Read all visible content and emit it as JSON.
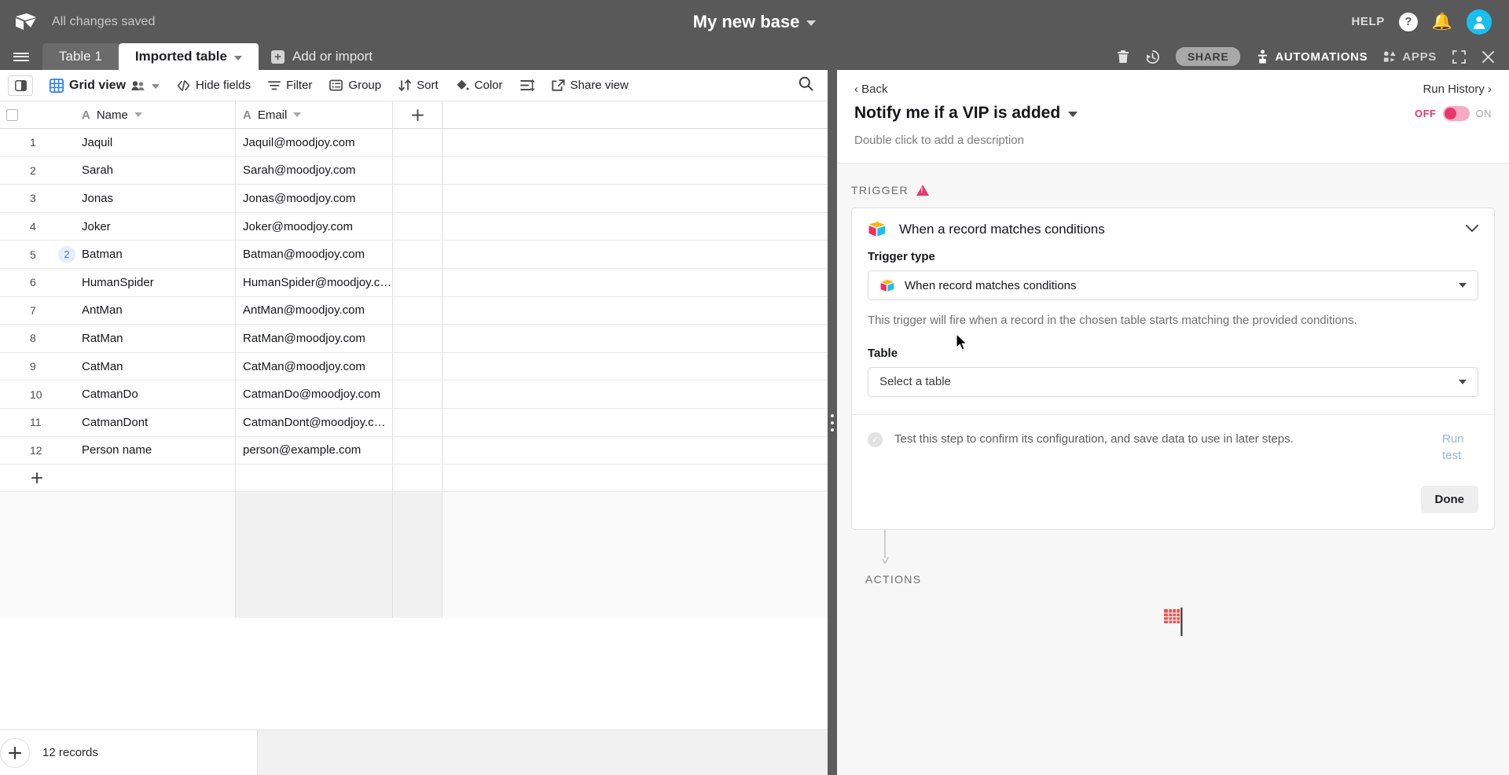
{
  "topbar": {
    "logo_icon": "airtable-logo-icon",
    "save_status": "All changes saved",
    "base_title": "My new base",
    "base_caret_icon": "chevron-down-icon",
    "help_label": "HELP",
    "help_icon": "question-circle-icon",
    "notifications_icon": "bell-icon",
    "avatar_icon": "user-avatar-icon",
    "avatar_color": "#18bfef"
  },
  "tabbar": {
    "menu_icon": "hamburger-menu-icon",
    "tabs": [
      {
        "label": "Table 1",
        "active": false
      },
      {
        "label": "Imported table",
        "active": true
      }
    ],
    "add_or_import": "Add or import",
    "add_icon": "plus-square-icon",
    "trash_icon": "trash-icon",
    "history_icon": "history-clock-icon",
    "share_label": "SHARE",
    "automations_label": "AUTOMATIONS",
    "automations_icon": "automations-robot-icon",
    "apps_label": "APPS",
    "apps_icon": "apps-blocks-icon",
    "expand_icon": "expand-icon",
    "close_icon": "close-icon"
  },
  "viewbar": {
    "sidepanel_icon": "side-panel-toggle-icon",
    "grid_icon": "grid-view-icon",
    "view_name": "Grid view",
    "collaborators_icon": "collaborators-icon",
    "view_caret_icon": "chevron-down-icon",
    "hide_fields": "Hide fields",
    "hide_fields_icon": "hide-fields-icon",
    "filter": "Filter",
    "filter_icon": "filter-icon",
    "group": "Group",
    "group_icon": "group-icon",
    "sort": "Sort",
    "sort_icon": "sort-icon",
    "color": "Color",
    "color_icon": "color-paint-icon",
    "row_height_icon": "row-height-icon",
    "share_view": "Share view",
    "share_view_icon": "share-external-icon",
    "search_icon": "search-icon"
  },
  "grid": {
    "columns": [
      {
        "name": "Name",
        "type_icon": "text-field-A-icon"
      },
      {
        "name": "Email",
        "type_icon": "text-field-A-icon"
      }
    ],
    "add_field_icon": "plus-icon",
    "rows": [
      {
        "num": "1",
        "name": "Jaquil",
        "email": "Jaquil@moodjoy.com",
        "badge": ""
      },
      {
        "num": "2",
        "name": "Sarah",
        "email": "Sarah@moodjoy.com",
        "badge": ""
      },
      {
        "num": "3",
        "name": "Jonas",
        "email": "Jonas@moodjoy.com",
        "badge": ""
      },
      {
        "num": "4",
        "name": "Joker",
        "email": "Joker@moodjoy.com",
        "badge": ""
      },
      {
        "num": "5",
        "name": "Batman",
        "email": "Batman@moodjoy.com",
        "badge": "2"
      },
      {
        "num": "6",
        "name": "HumanSpider",
        "email": "HumanSpider@moodjoy.c…",
        "badge": ""
      },
      {
        "num": "7",
        "name": "AntMan",
        "email": "AntMan@moodjoy.com",
        "badge": ""
      },
      {
        "num": "8",
        "name": "RatMan",
        "email": "RatMan@moodjoy.com",
        "badge": ""
      },
      {
        "num": "9",
        "name": "CatMan",
        "email": "CatMan@moodjoy.com",
        "badge": ""
      },
      {
        "num": "10",
        "name": "CatmanDo",
        "email": "CatmanDo@moodjoy.com",
        "badge": ""
      },
      {
        "num": "11",
        "name": "CatmanDont",
        "email": "CatmanDont@moodjoy.c…",
        "badge": ""
      },
      {
        "num": "12",
        "name": "Person name",
        "email": "person@example.com",
        "badge": ""
      }
    ],
    "add_row_icon": "plus-icon",
    "record_count": "12 records",
    "add_record_icon": "plus-icon"
  },
  "divider": {
    "handle_icon": "drag-handle-dots-icon"
  },
  "panel": {
    "back_label": "‹ Back",
    "run_history_label": "Run History ›",
    "automation_name": "Notify me if a VIP is added",
    "name_caret_icon": "chevron-down-icon",
    "toggle_off_label": "OFF",
    "toggle_on_label": "ON",
    "toggle_state": "off",
    "toggle_color": "#e8366f",
    "description_placeholder": "Double click to add a description",
    "trigger_section_label": "TRIGGER",
    "warning_icon": "warning-triangle-icon",
    "trigger_card": {
      "icon": "airtable-cube-icon",
      "title": "When a record matches conditions",
      "collapse_icon": "chevron-down-icon",
      "trigger_type_label": "Trigger type",
      "trigger_type_value": "When record matches conditions",
      "trigger_type_icon": "airtable-cube-icon",
      "trigger_type_caret": "caret-down-icon",
      "helper_text": "This trigger will fire when a record in the chosen table starts matching the provided conditions.",
      "table_label": "Table",
      "table_value": "Select a table",
      "table_caret": "caret-down-icon",
      "test_status_icon": "check-circle-icon",
      "test_text": "Test this step to confirm its configuration, and save data to use in later steps.",
      "run_test_label": "Run test",
      "done_label": "Done"
    },
    "flow_arrow_icon": "arrow-down-icon",
    "actions_section_label": "ACTIONS",
    "flag_icon": "checkered-flag-icon"
  },
  "cursor": {
    "icon": "mouse-pointer-icon"
  }
}
